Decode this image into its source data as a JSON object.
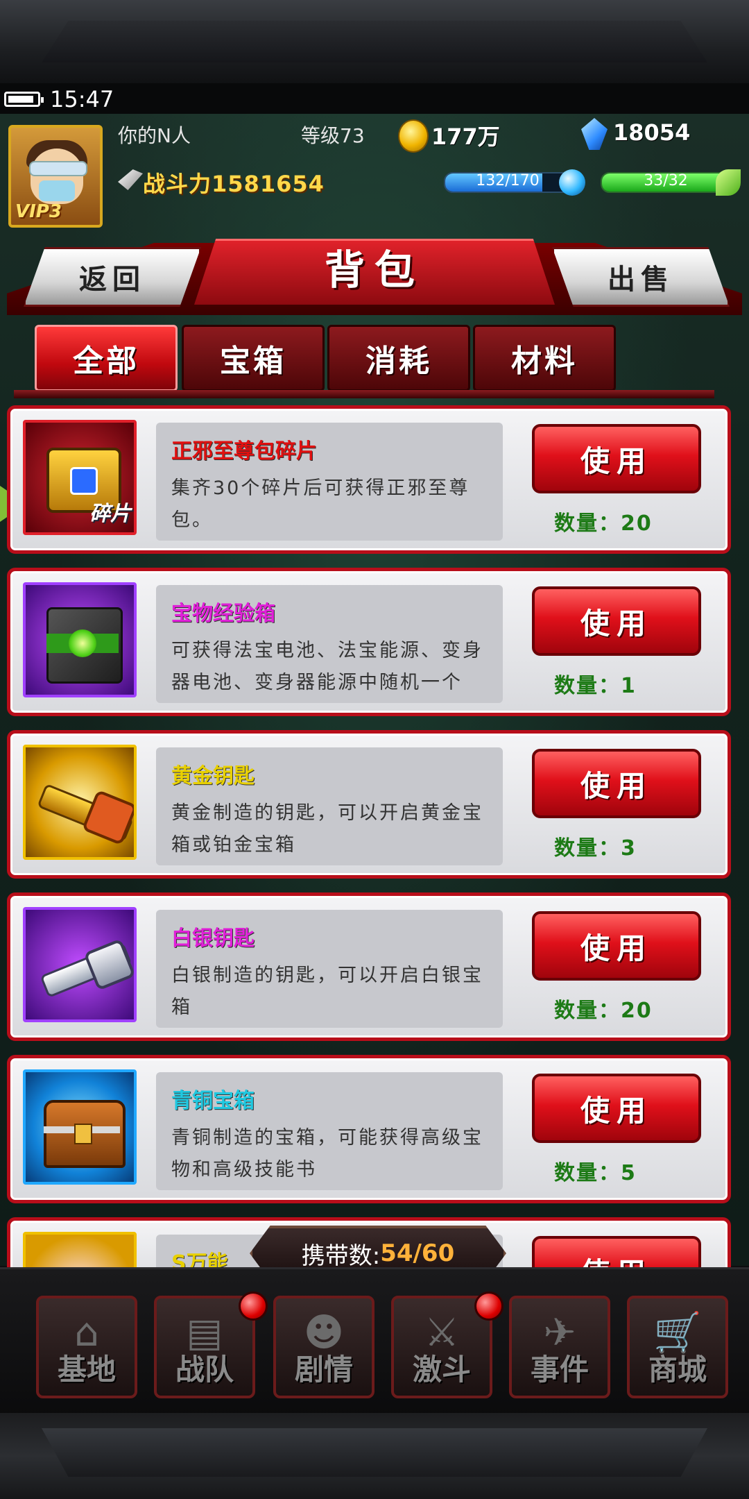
{
  "status_bar": {
    "time": "15:47"
  },
  "player": {
    "vip": "VIP3",
    "name": "你的N人",
    "level_label": "等级73",
    "gold": "177万",
    "gems": "18054",
    "power_label": "战斗力",
    "power_value": "1581654",
    "energy_text": "132/170",
    "energy_fraction": 0.776,
    "stamina_text": "33/32",
    "stamina_fraction": 1.0
  },
  "header": {
    "title": "背包",
    "back_label": "返回",
    "sell_label": "出售"
  },
  "tabs": [
    {
      "label": "全部",
      "active": true
    },
    {
      "label": "宝箱",
      "active": false
    },
    {
      "label": "消耗",
      "active": false
    },
    {
      "label": "材料",
      "active": false
    }
  ],
  "items": [
    {
      "name": "正邪至尊包碎片",
      "name_color": "#e01010",
      "desc": "集齐30个碎片后可获得正邪至尊包。",
      "use_label": "使用",
      "qty": "数量：20",
      "icon": "fragment-chest-icon",
      "badge": "碎片",
      "frame_color": "#e0202a"
    },
    {
      "name": "宝物经验箱",
      "name_color": "#e020d8",
      "desc": "可获得法宝电池、法宝能源、变身器电池、变身器能源中随机一个",
      "use_label": "使用",
      "qty": "数量：1",
      "icon": "exp-cube-icon",
      "frame_color": "#a040ff"
    },
    {
      "name": "黄金钥匙",
      "name_color": "#e8d000",
      "desc": "黄金制造的钥匙，可以开启黄金宝箱或铂金宝箱",
      "use_label": "使用",
      "qty": "数量：3",
      "icon": "gold-key-icon",
      "frame_color": "#f0c000"
    },
    {
      "name": "白银钥匙",
      "name_color": "#e020d8",
      "desc": "白银制造的钥匙，可以开启白银宝箱",
      "use_label": "使用",
      "qty": "数量：20",
      "icon": "silver-key-icon",
      "frame_color": "#a040ff"
    },
    {
      "name": "青铜宝箱",
      "name_color": "#20c8e0",
      "desc": "青铜制造的宝箱，可能获得高级宝物和高级技能书",
      "use_label": "使用",
      "qty": "数量：5",
      "icon": "bronze-chest-icon",
      "frame_color": "#20a8ff"
    },
    {
      "name": "S万能",
      "name_color": "#e8d000",
      "use_label": "使用",
      "icon": "crystal-icon",
      "frame_color": "#f0c000"
    }
  ],
  "carry": {
    "label": "携带数:",
    "count": "54/60"
  },
  "bottom_nav": [
    {
      "label": "基地",
      "icon": "base-icon",
      "badge": false
    },
    {
      "label": "战队",
      "icon": "team-icon",
      "badge": true
    },
    {
      "label": "剧情",
      "icon": "story-icon",
      "badge": false
    },
    {
      "label": "激斗",
      "icon": "battle-icon",
      "badge": true
    },
    {
      "label": "事件",
      "icon": "event-icon",
      "badge": false
    },
    {
      "label": "商城",
      "icon": "shop-cart-icon",
      "badge": false
    }
  ]
}
